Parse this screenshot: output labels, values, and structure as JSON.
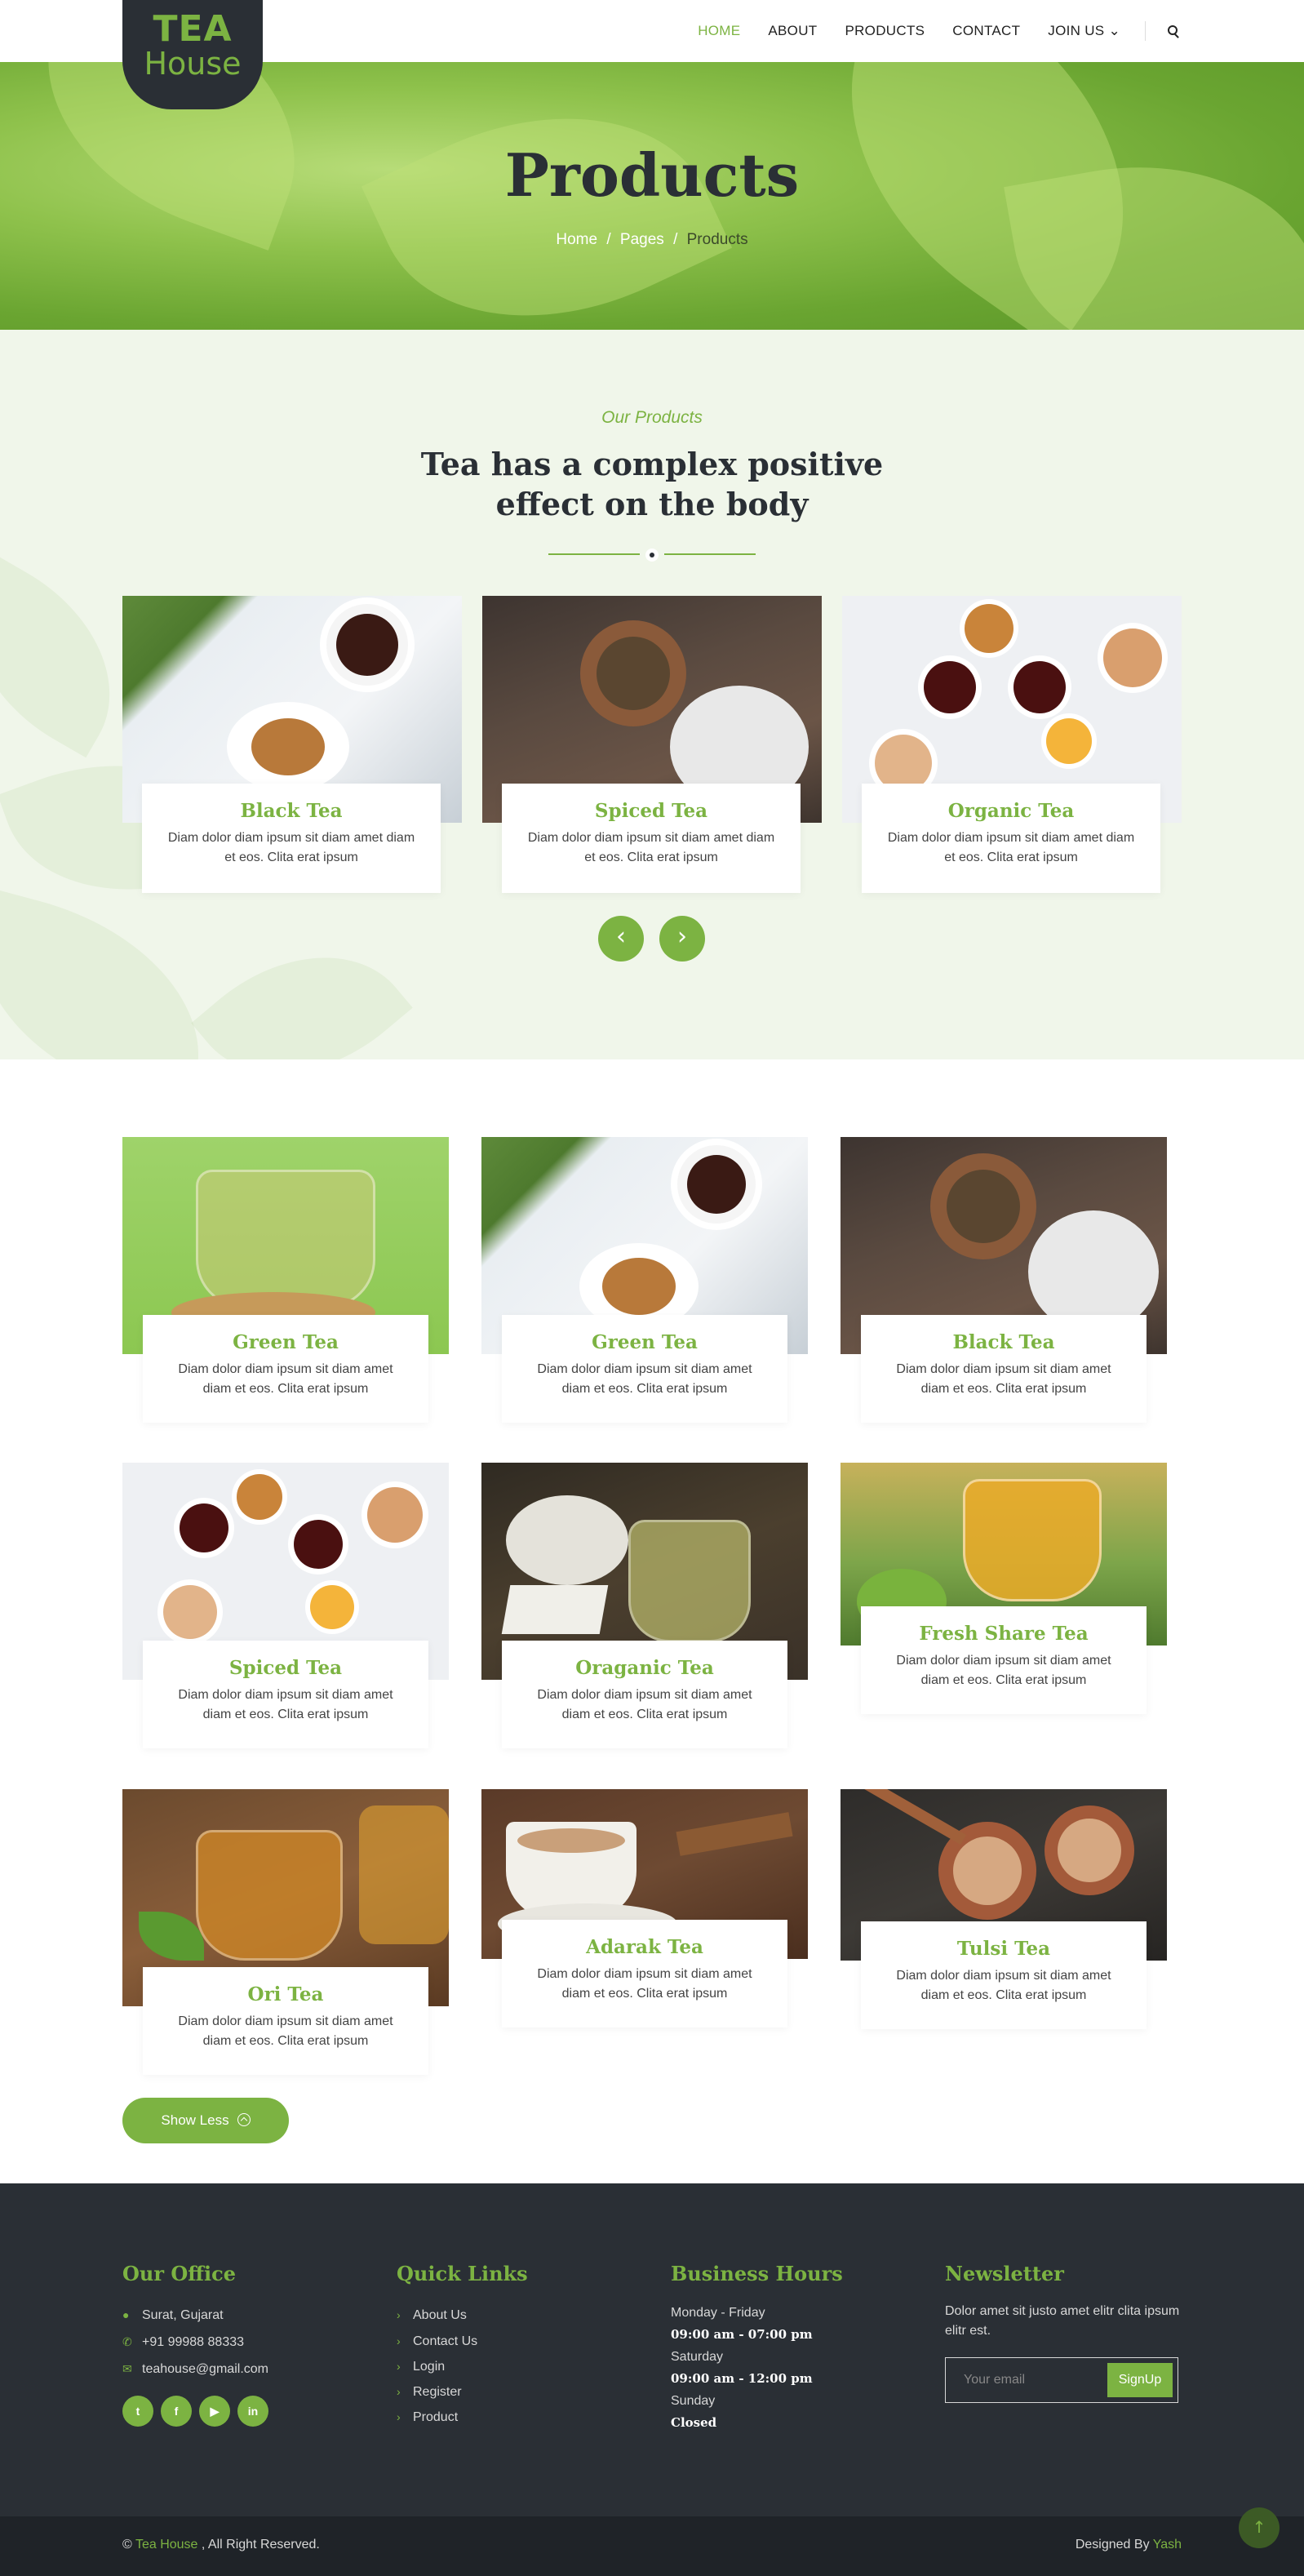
{
  "logo": {
    "line1": "TEA",
    "line2": "House"
  },
  "nav": {
    "items": [
      {
        "label": "HOME",
        "active": true
      },
      {
        "label": "ABOUT",
        "active": false
      },
      {
        "label": "PRODUCTS",
        "active": false
      },
      {
        "label": "CONTACT",
        "active": false
      },
      {
        "label": "JOIN US ⌄",
        "active": false
      }
    ],
    "search_icon": "search-icon"
  },
  "hero": {
    "title": "Products",
    "breadcrumb": {
      "home": "Home",
      "sep1": "/",
      "pages": "Pages",
      "sep2": "/",
      "current": "Products"
    }
  },
  "our_products": {
    "subtitle": "Our Products",
    "title_line1": "Tea has a complex positive",
    "title_line2": "effect on the body",
    "cards": [
      {
        "title": "Black Tea",
        "desc": "Diam dolor diam ipsum sit diam amet diam et eos. Clita erat ipsum"
      },
      {
        "title": "Spiced Tea",
        "desc": "Diam dolor diam ipsum sit diam amet diam et eos. Clita erat ipsum"
      },
      {
        "title": "Organic Tea",
        "desc": "Diam dolor diam ipsum sit diam amet diam et eos. Clita erat ipsum"
      }
    ],
    "prev_arrow": "‹",
    "next_arrow": "›"
  },
  "grid": {
    "cards": [
      {
        "title": "Green Tea",
        "desc": "Diam dolor diam ipsum sit diam amet diam et eos. Clita erat ipsum"
      },
      {
        "title": "Green Tea",
        "desc": "Diam dolor diam ipsum sit diam amet diam et eos. Clita erat ipsum"
      },
      {
        "title": "Black Tea",
        "desc": "Diam dolor diam ipsum sit diam amet diam et eos. Clita erat ipsum"
      },
      {
        "title": "Spiced Tea",
        "desc": "Diam dolor diam ipsum sit diam amet diam et eos. Clita erat ipsum"
      },
      {
        "title": "Oraganic Tea",
        "desc": "Diam dolor diam ipsum sit diam amet diam et eos. Clita erat ipsum"
      },
      {
        "title": "Fresh Share Tea",
        "desc": "Diam dolor diam ipsum sit diam amet diam et eos. Clita erat ipsum"
      },
      {
        "title": "Ori Tea",
        "desc": "Diam dolor diam ipsum sit diam amet diam et eos. Clita erat ipsum"
      },
      {
        "title": "Adarak Tea",
        "desc": "Diam dolor diam ipsum sit diam amet diam et eos. Clita erat ipsum"
      },
      {
        "title": "Tulsi Tea",
        "desc": "Diam dolor diam ipsum sit diam amet diam et eos. Clita erat ipsum"
      }
    ],
    "show_less_label": "Show Less"
  },
  "footer": {
    "office": {
      "heading": "Our Office",
      "address": "Surat, Gujarat",
      "phone": "+91 99988 88333",
      "email": "teahouse@gmail.com",
      "socials": [
        "twitter-icon",
        "facebook-icon",
        "youtube-icon",
        "linkedin-icon"
      ]
    },
    "links": {
      "heading": "Quick Links",
      "items": [
        "About Us",
        "Contact Us",
        "Login",
        "Register",
        "Product"
      ]
    },
    "hours": {
      "heading": "Business Hours",
      "d1": "Monday - Friday",
      "h1": "09:00 am - 07:00 pm",
      "d2": "Saturday",
      "h2": "09:00 am - 12:00 pm",
      "d3": "Sunday",
      "h3": "Closed"
    },
    "newsletter": {
      "heading": "Newsletter",
      "text": "Dolor amet sit justo amet elitr clita ipsum elitr est.",
      "placeholder": "Your email",
      "button": "SignUp"
    }
  },
  "copyright": {
    "prefix": "©",
    "brand": "Tea House",
    "suffix": ", All Right Reserved.",
    "designed_by": "Designed By",
    "designer": "Yash"
  },
  "colors": {
    "accent": "#7cb342",
    "dark": "#2a2f35",
    "section_bg": "#f0f6ea"
  }
}
